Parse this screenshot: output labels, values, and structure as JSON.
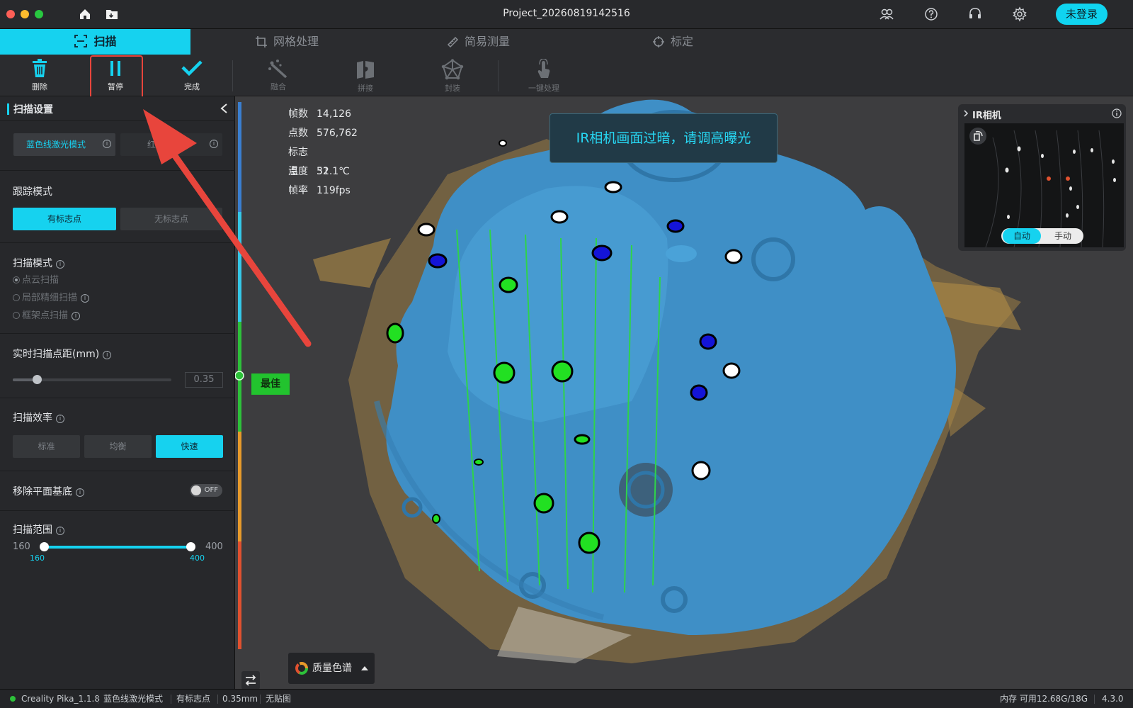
{
  "window": {
    "title": "Project_20260819142516",
    "login_label": "未登录"
  },
  "tabs": [
    {
      "label": "扫描",
      "active": true
    },
    {
      "label": "网格处理"
    },
    {
      "label": "简易测量"
    },
    {
      "label": "标定"
    }
  ],
  "toolbar": {
    "delete": "删除",
    "pause": "暂停",
    "done": "完成",
    "fuse": "融合",
    "stitch": "拼接",
    "encapsulate": "封装",
    "one_click": "一键处理"
  },
  "sidebar": {
    "title": "扫描设置",
    "laser_mode": {
      "blue": "蓝色线激光模式",
      "red": "红外激光",
      "selected": "blue"
    },
    "tracking": {
      "title": "跟踪模式",
      "with_markers": "有标志点",
      "without_markers": "无标志点",
      "selected": "with_markers"
    },
    "scan_mode": {
      "title": "扫描模式",
      "options": [
        "点云扫描",
        "局部精细扫描",
        "框架点扫描"
      ],
      "selected": 0
    },
    "point_distance": {
      "title": "实时扫描点距(mm)",
      "value": "0.35",
      "slider_fraction": 0.15
    },
    "efficiency": {
      "title": "扫描效率",
      "options": [
        "标准",
        "均衡",
        "快速"
      ],
      "selected": 2
    },
    "remove_plane": {
      "title": "移除平面基底",
      "toggle": "OFF"
    },
    "range": {
      "title": "扫描范围",
      "min": "160",
      "max": "400",
      "low": "160",
      "high": "400"
    }
  },
  "stats": [
    {
      "k": "帧数",
      "v": "14,126"
    },
    {
      "k": "点数",
      "v": "576,762"
    },
    {
      "k": "标志点",
      "v": "51"
    },
    {
      "k": "温度",
      "v": "32.1℃"
    },
    {
      "k": "帧率",
      "v": "119fps"
    }
  ],
  "toast": "IR相机画面过暗，请调高曝光",
  "distance_label": "最佳",
  "ir_camera": {
    "title": "IR相机",
    "auto": "自动",
    "manual": "手动"
  },
  "palette_label": "质量色谱",
  "status": {
    "app": "Creality Pika_1.1.8",
    "mode": "蓝色线激光模式",
    "tracking": "有标志点",
    "distance": "0.35mm",
    "texture": "无贴图",
    "memory": "内存 可用12.68G/18G",
    "version": "4.3.0"
  },
  "colors": {
    "accent": "#16d2ef",
    "best": "#22c32e",
    "alert": "#e8453c",
    "model": "#3f8fc6",
    "cloud": "#c79b47"
  }
}
